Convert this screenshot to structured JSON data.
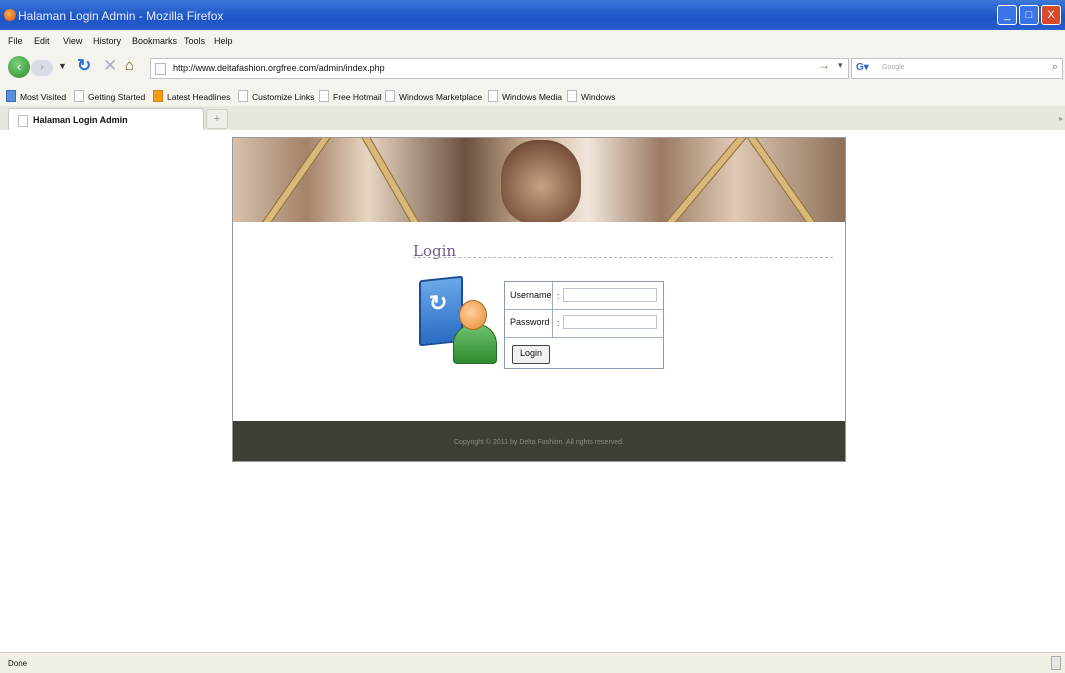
{
  "window": {
    "title": "Halaman Login Admin - Mozilla Firefox",
    "controls": [
      "_",
      "□",
      "X"
    ]
  },
  "menu": [
    "File",
    "Edit",
    "View",
    "History",
    "Bookmarks",
    "Tools",
    "Help"
  ],
  "nav": {
    "url": "http://www.deltafashion.orgfree.com/admin/index.php",
    "search_engine": "Google",
    "search_placeholder": "Google"
  },
  "bookmarks": [
    "Most Visited",
    "Getting Started",
    "Latest Headlines",
    "Customize Links",
    "Free Hotmail",
    "Windows Marketplace",
    "Windows Media",
    "Windows"
  ],
  "tab": {
    "label": "Halaman Login Admin"
  },
  "page": {
    "login_title": "Login",
    "username_label": "Username",
    "password_label": "Password",
    "colon": ":",
    "login_button": "Login",
    "footer": "Copyright © 2011 by Delta Fashion. All rights reserved."
  },
  "status": {
    "text": "Done"
  }
}
